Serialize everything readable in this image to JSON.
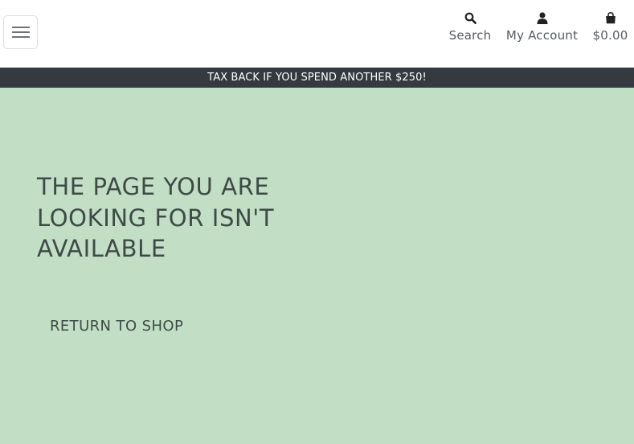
{
  "header": {
    "menu_icon": "hamburger-menu-icon",
    "nav": {
      "search": {
        "label": "Search",
        "icon": "search-icon"
      },
      "account": {
        "label": "My Account",
        "icon": "user-icon"
      },
      "cart": {
        "label": "$0.00",
        "icon": "shopping-bag-icon"
      }
    }
  },
  "promo": {
    "text": "TAX BACK IF YOU SPEND ANOTHER $250!"
  },
  "main": {
    "title": "THE PAGE YOU ARE LOOKING FOR ISN'T AVAILABLE",
    "return_link": "RETURN TO SHOP"
  },
  "colors": {
    "promo_background": "#343a40",
    "main_background": "#c2dfc5",
    "text": "#3f4a48"
  }
}
